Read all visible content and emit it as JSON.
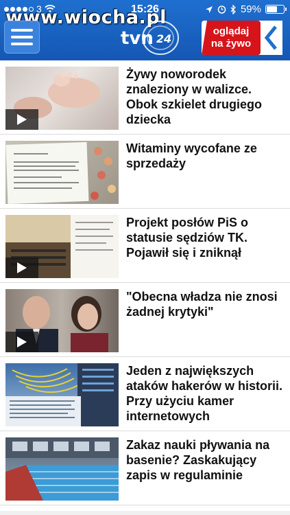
{
  "status_bar": {
    "carrier": "3",
    "time": "15:26",
    "battery": "59%",
    "battery_level": 0.59,
    "signal_icon": "signal-dots-icon",
    "wifi_icon": "wifi-icon",
    "location_icon": "location-arrow-icon",
    "alarm_icon": "alarm-clock-icon",
    "bluetooth_icon": "bluetooth-icon"
  },
  "watermark": "www.wiocha.pl",
  "header": {
    "menu_icon": "hamburger-menu-icon",
    "logo_text": "tvn",
    "logo_number": "24",
    "live_line1": "oglądaj",
    "live_line2": "na żywo",
    "live_icon": "chevron-left-icon"
  },
  "colors": {
    "header_blue": "#1f6fd0",
    "live_red": "#d7141a"
  },
  "articles": [
    {
      "title": "Żywy noworodek znaleziony w walizce. Obok szkielet drugiego dziecka",
      "has_video": true
    },
    {
      "title": "Witaminy wycofane ze sprzedaży",
      "has_video": false
    },
    {
      "title": "Projekt posłów PiS o statusie sędziów TK. Pojawił się i zniknął",
      "has_video": true
    },
    {
      "title": "\"Obecna władza nie znosi żadnej krytyki\"",
      "has_video": true
    },
    {
      "title": "Jeden z największych ataków hakerów w historii. Przy użyciu kamer internetowych",
      "has_video": false
    },
    {
      "title": "Zakaz nauki pływania na basenie? Zaskakujący zapis w regulaminie",
      "has_video": false
    }
  ]
}
